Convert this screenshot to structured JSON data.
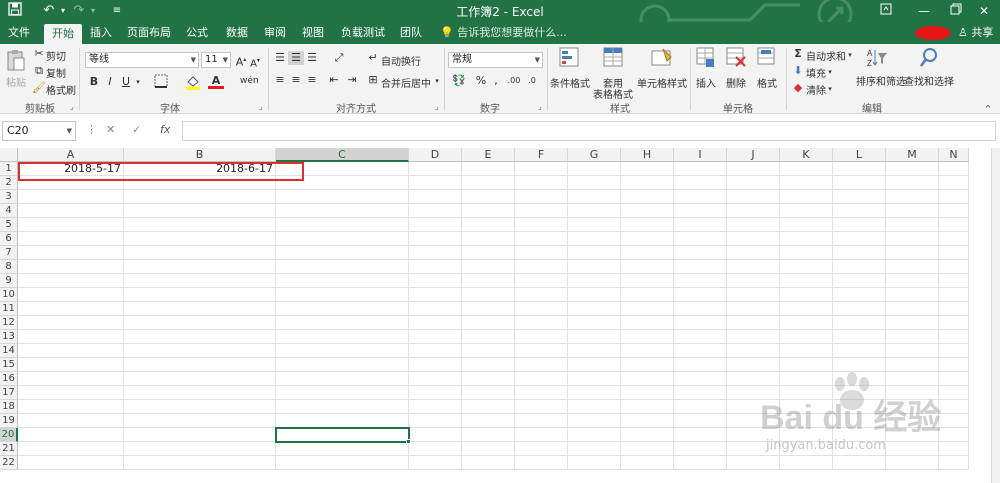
{
  "titlebar": {
    "title": "工作簿2 - Excel",
    "save_icon": "save-icon",
    "undo_icon": "undo-icon",
    "redo_icon": "redo-icon"
  },
  "tabs": [
    {
      "label": "文件",
      "active": false
    },
    {
      "label": "开始",
      "active": true
    },
    {
      "label": "插入",
      "active": false
    },
    {
      "label": "页面布局",
      "active": false
    },
    {
      "label": "公式",
      "active": false
    },
    {
      "label": "数据",
      "active": false
    },
    {
      "label": "审阅",
      "active": false
    },
    {
      "label": "视图",
      "active": false
    },
    {
      "label": "负载测试",
      "active": false
    },
    {
      "label": "团队",
      "active": false
    }
  ],
  "tellme": "告诉我您想要做什么...",
  "share": "共享",
  "ribbon": {
    "clipboard": {
      "label": "剪贴板",
      "paste": "粘贴",
      "cut": "剪切",
      "copy": "复制",
      "format_painter": "格式刷"
    },
    "font": {
      "label": "字体",
      "font_name": "等线",
      "font_size": "11",
      "bold": "B",
      "italic": "I",
      "underline": "U"
    },
    "alignment": {
      "label": "对齐方式",
      "wrap": "自动换行",
      "merge": "合并后居中"
    },
    "number": {
      "label": "数字",
      "format": "常规"
    },
    "styles": {
      "label": "样式",
      "conditional": "条件格式",
      "table_line1": "套用",
      "table_line2": "表格格式",
      "cell_styles": "单元格样式"
    },
    "cells": {
      "label": "单元格",
      "insert": "插入",
      "delete": "删除",
      "format": "格式"
    },
    "editing": {
      "label": "编辑",
      "autosum": "自动求和",
      "fill": "填充",
      "clear": "清除",
      "sort": "排序和筛选",
      "find": "查找和选择"
    }
  },
  "formula_bar": {
    "name_box": "C20",
    "fx": "fx",
    "value": ""
  },
  "columns": [
    "A",
    "B",
    "C",
    "D",
    "E",
    "F",
    "G",
    "H",
    "I",
    "J",
    "K",
    "L",
    "M",
    "N"
  ],
  "rows": [
    "1",
    "2",
    "3",
    "4",
    "5",
    "6",
    "7",
    "8",
    "9",
    "10",
    "11",
    "12",
    "13",
    "14",
    "15",
    "16",
    "17",
    "18",
    "19",
    "20",
    "21",
    "22"
  ],
  "cells": {
    "A1": "2018-5-17",
    "B1": "2018-6-17"
  },
  "active_cell": "C20",
  "watermark": {
    "brand": "Bai du 经验",
    "url": "jingyan.baidu.com"
  }
}
